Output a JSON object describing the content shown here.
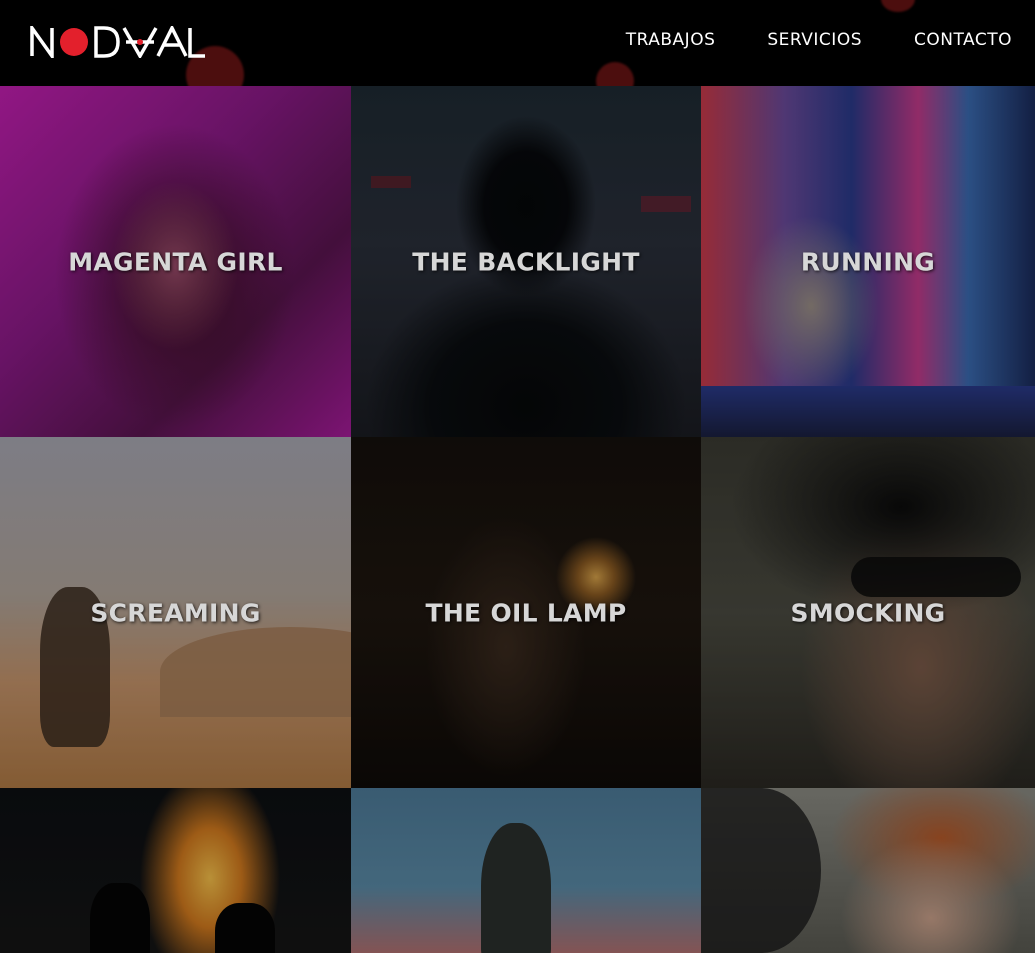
{
  "brand": {
    "name": "NODAAL",
    "accent": "#e3202c"
  },
  "nav": {
    "items": [
      {
        "label": "TRABAJOS"
      },
      {
        "label": "SERVICIOS"
      },
      {
        "label": "CONTACTO"
      }
    ]
  },
  "tiles": [
    {
      "title": "MAGENTA GIRL"
    },
    {
      "title": "THE BACKLIGHT"
    },
    {
      "title": "RUNNING"
    },
    {
      "title": "SCREAMING"
    },
    {
      "title": "THE OIL LAMP"
    },
    {
      "title": "SMOCKING"
    },
    {
      "title": ""
    },
    {
      "title": ""
    },
    {
      "title": ""
    }
  ]
}
